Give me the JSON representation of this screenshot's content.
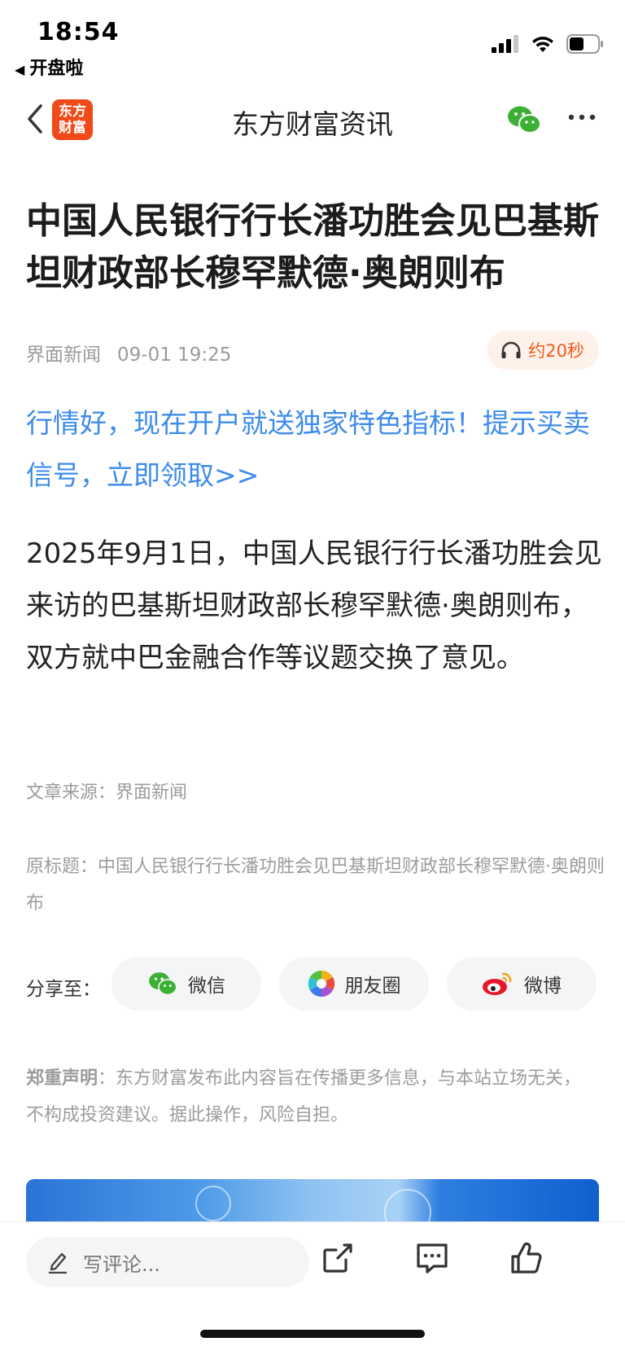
{
  "status": {
    "time": "18:54",
    "back_app": "开盘啦"
  },
  "nav": {
    "logo_line1": "东方",
    "logo_line2": "财富",
    "title": "东方财富资讯"
  },
  "article": {
    "headline": "中国人民银行行长潘功胜会见巴基斯坦财政部长穆罕默德·奥朗则布",
    "source_name": "界面新闻",
    "publish_time": "09-01 19:25",
    "listen_label": "约20秒",
    "promo_text": "行情好，现在开户就送独家特色指标！提示买卖信号，立即领取>>",
    "body": "2025年9月1日，中国人民银行行长潘功胜会见来访的巴基斯坦财政部长穆罕默德·奥朗则布，双方就中巴金融合作等议题交换了意见。",
    "source_line": "文章来源：界面新闻",
    "original_title": "原标题：中国人民银行行长潘功胜会见巴基斯坦财政部长穆罕默德·奥朗则布"
  },
  "share": {
    "label": "分享至：",
    "wechat": "微信",
    "moments": "朋友圈",
    "weibo": "微博"
  },
  "disclaimer": {
    "title": "郑重声明",
    "text": "：东方财富发布此内容旨在传播更多信息，与本站立场无关，不构成投资建议。据此操作，风险自担。"
  },
  "bottom_bar": {
    "comment_placeholder": "写评论..."
  },
  "colors": {
    "brand": "#f04a1a",
    "link": "#3d8bea",
    "wechat_green": "#3cb035"
  }
}
